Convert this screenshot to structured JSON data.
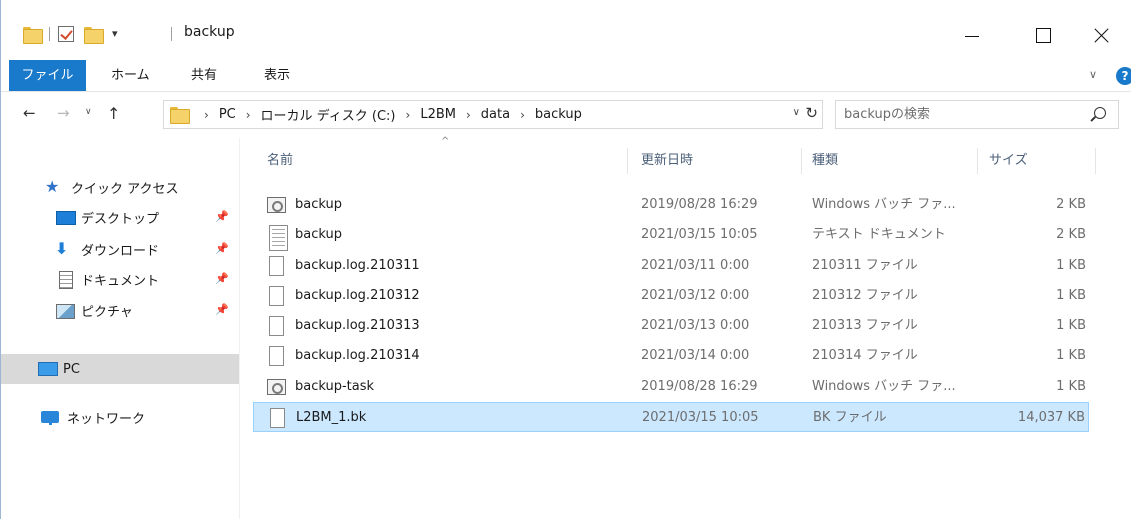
{
  "window": {
    "title": "backup",
    "controls": {
      "minimize": "minimize",
      "maximize": "maximize",
      "close": "close"
    }
  },
  "ribbon": {
    "tabs": [
      {
        "label": "ファイル",
        "active": true
      },
      {
        "label": "ホーム"
      },
      {
        "label": "共有"
      },
      {
        "label": "表示"
      }
    ]
  },
  "address": {
    "breadcrumbs": [
      "PC",
      "ローカル ディスク (C:)",
      "L2BM",
      "data",
      "backup"
    ]
  },
  "search": {
    "placeholder": "backupの検索"
  },
  "sidebar": {
    "items": [
      {
        "label": "クイック アクセス",
        "icon": "star-icon"
      },
      {
        "label": "デスクトップ",
        "icon": "desktop-icon",
        "pinned": true
      },
      {
        "label": "ダウンロード",
        "icon": "download-icon",
        "pinned": true
      },
      {
        "label": "ドキュメント",
        "icon": "documents-icon",
        "pinned": true
      },
      {
        "label": "ピクチャ",
        "icon": "pictures-icon",
        "pinned": true
      },
      {
        "label": "PC",
        "icon": "pc-icon",
        "selected": true
      },
      {
        "label": "ネットワーク",
        "icon": "network-icon"
      }
    ]
  },
  "columns": {
    "name": "名前",
    "date": "更新日時",
    "type": "種類",
    "size": "サイズ"
  },
  "files": [
    {
      "name": "backup",
      "date": "2019/08/28 16:29",
      "type": "Windows バッチ ファ...",
      "size": "2 KB",
      "icon": "batch-file-icon"
    },
    {
      "name": "backup",
      "date": "2021/03/15 10:05",
      "type": "テキスト ドキュメント",
      "size": "2 KB",
      "icon": "text-file-icon"
    },
    {
      "name": "backup.log.210311",
      "date": "2021/03/11 0:00",
      "type": "210311 ファイル",
      "size": "1 KB",
      "icon": "file-icon"
    },
    {
      "name": "backup.log.210312",
      "date": "2021/03/12 0:00",
      "type": "210312 ファイル",
      "size": "1 KB",
      "icon": "file-icon"
    },
    {
      "name": "backup.log.210313",
      "date": "2021/03/13 0:00",
      "type": "210313 ファイル",
      "size": "1 KB",
      "icon": "file-icon"
    },
    {
      "name": "backup.log.210314",
      "date": "2021/03/14 0:00",
      "type": "210314 ファイル",
      "size": "1 KB",
      "icon": "file-icon"
    },
    {
      "name": "backup-task",
      "date": "2019/08/28 16:29",
      "type": "Windows バッチ ファ...",
      "size": "1 KB",
      "icon": "batch-file-icon"
    },
    {
      "name": "L2BM_1.bk",
      "date": "2021/03/15 10:05",
      "type": "BK ファイル",
      "size": "14,037 KB",
      "icon": "file-icon",
      "selected": true
    }
  ],
  "colors": {
    "accent": "#1979ca",
    "selection": "#cce8ff",
    "selection_border": "#99d1ff",
    "sidebar_selected": "#d9d9d9"
  }
}
